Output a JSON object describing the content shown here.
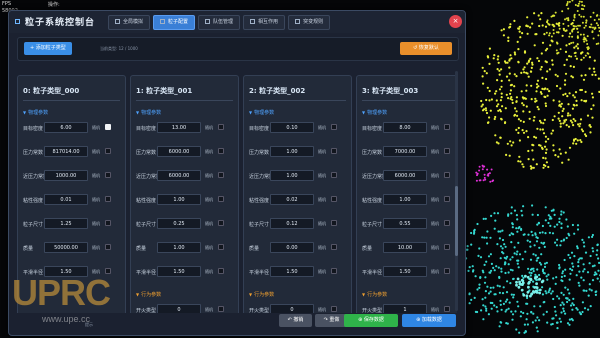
{
  "hud": {
    "line1": "FPS",
    "line2": "58002",
    "line3": "操作:"
  },
  "window": {
    "title": "粒子系统控制台",
    "tabs": [
      "全局模拟",
      "粒子配置",
      "队伍管理",
      "相互作用",
      "突变规则"
    ],
    "active_tab": 1,
    "close_label": "×"
  },
  "toolbar": {
    "add_label": "+ 添加粒子类型",
    "count_text": "当前类型: 12 / 1000",
    "reset_label": "↺ 恢复默认"
  },
  "panels": [
    {
      "title": "0: 粒子类型_000",
      "params": [
        {
          "label": "目标密度",
          "value": "6.00",
          "random": "随机",
          "checked": true
        },
        {
          "label": "压力常数",
          "value": "817014.00",
          "random": "随机",
          "checked": false
        },
        {
          "label": "近压力常数",
          "value": "1000.00",
          "random": "随机",
          "checked": false
        },
        {
          "label": "粘性强度",
          "value": "0.01",
          "random": "随机",
          "checked": false
        },
        {
          "label": "粒子尺寸",
          "value": "1.25",
          "random": "随机",
          "checked": false
        },
        {
          "label": "质量",
          "value": "50000.00",
          "random": "随机",
          "checked": false
        },
        {
          "label": "平滑半径",
          "value": "1.50",
          "random": "随机",
          "checked": false
        }
      ],
      "behavior": []
    },
    {
      "title": "1: 粒子类型_001",
      "params": [
        {
          "label": "目标密度",
          "value": "13.00",
          "random": "随机",
          "checked": false
        },
        {
          "label": "压力常数",
          "value": "6000.00",
          "random": "随机",
          "checked": false
        },
        {
          "label": "近压力常数",
          "value": "6000.00",
          "random": "随机",
          "checked": false
        },
        {
          "label": "粘性强度",
          "value": "1.00",
          "random": "随机",
          "checked": false
        },
        {
          "label": "粒子尺寸",
          "value": "0.25",
          "random": "随机",
          "checked": false
        },
        {
          "label": "质量",
          "value": "1.00",
          "random": "随机",
          "checked": false
        },
        {
          "label": "平滑半径",
          "value": "1.50",
          "random": "随机",
          "checked": false
        }
      ],
      "behavior": [
        {
          "label": "开火类型",
          "value": "0",
          "random": "随机",
          "checked": false
        }
      ]
    },
    {
      "title": "2: 粒子类型_002",
      "params": [
        {
          "label": "目标密度",
          "value": "0.10",
          "random": "随机",
          "checked": false
        },
        {
          "label": "压力常数",
          "value": "1.00",
          "random": "随机",
          "checked": false
        },
        {
          "label": "近压力常数",
          "value": "1.00",
          "random": "随机",
          "checked": false
        },
        {
          "label": "粘性强度",
          "value": "0.02",
          "random": "随机",
          "checked": false
        },
        {
          "label": "粒子尺寸",
          "value": "0.12",
          "random": "随机",
          "checked": false
        },
        {
          "label": "质量",
          "value": "0.00",
          "random": "随机",
          "checked": false
        },
        {
          "label": "平滑半径",
          "value": "1.50",
          "random": "随机",
          "checked": false
        }
      ],
      "behavior": [
        {
          "label": "开火类型",
          "value": "0",
          "random": "随机",
          "checked": false
        }
      ]
    },
    {
      "title": "3: 粒子类型_003",
      "params": [
        {
          "label": "目标密度",
          "value": "8.00",
          "random": "随机",
          "checked": false
        },
        {
          "label": "压力常数",
          "value": "7000.00",
          "random": "随机",
          "checked": false
        },
        {
          "label": "近压力常数",
          "value": "6000.00",
          "random": "随机",
          "checked": false
        },
        {
          "label": "粘性强度",
          "value": "1.00",
          "random": "随机",
          "checked": false
        },
        {
          "label": "粒子尺寸",
          "value": "0.55",
          "random": "随机",
          "checked": false
        },
        {
          "label": "质量",
          "value": "10.00",
          "random": "随机",
          "checked": false
        },
        {
          "label": "平滑半径",
          "value": "1.50",
          "random": "随机",
          "checked": false
        }
      ],
      "behavior": [
        {
          "label": "开火类型",
          "value": "1",
          "random": "随机",
          "checked": false
        }
      ]
    }
  ],
  "section_labels": {
    "physics": "物理参数",
    "behavior": "行为参数"
  },
  "footer": {
    "label": "提示",
    "undo_label": "↶ 撤销",
    "redo_label": "↷ 重做",
    "save_label": "⊕ 保存数据",
    "load_label": "⊕ 加载数据"
  },
  "watermark": {
    "big": "UPRC",
    "small": "www.upe.cc"
  },
  "colors": {
    "accent": "#3a8fe8",
    "reset": "#e98f2b",
    "save": "#2fb34a",
    "load": "#2f86e4",
    "close": "#e2434d",
    "section": "#4fa3ff",
    "behavior_section": "#f0a030"
  }
}
